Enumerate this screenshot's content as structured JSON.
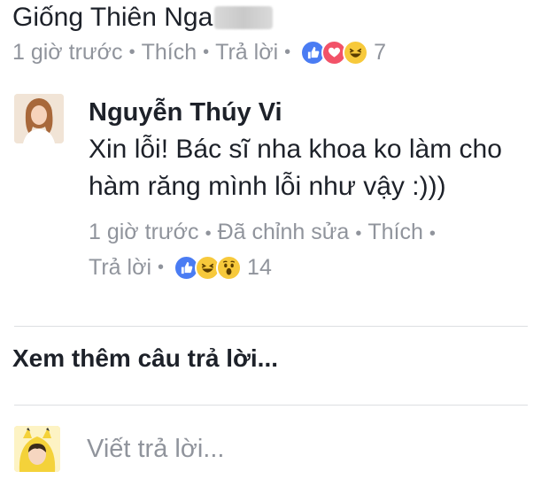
{
  "top_comment": {
    "author": "Giống Thiên Nga",
    "time": "1 giờ trước",
    "like_label": "Thích",
    "reply_label": "Trả lời",
    "reaction_icons": [
      "like-icon",
      "love-icon",
      "haha-icon"
    ],
    "reaction_count": "7"
  },
  "reply": {
    "author": "Nguyễn Thúy Vi",
    "text": "Xin lỗi! Bác sĩ nha khoa ko làm cho hàm răng mình lỗi như vậy :)))",
    "time": "1 giờ trước",
    "edited_label": "Đã chỉnh sửa",
    "like_label": "Thích",
    "reply_label": "Trả lời",
    "reaction_icons": [
      "like-icon",
      "haha-icon",
      "wow-icon"
    ],
    "reaction_count": "14"
  },
  "see_more_label": "Xem thêm câu trả lời...",
  "composer": {
    "placeholder": "Viết trả lời..."
  },
  "colors": {
    "meta_gray": "#90949c",
    "like_blue": "#4a7cf3",
    "love_red": "#f25268",
    "emoji_yellow": "#f7c93b",
    "divider": "#dddfe2"
  }
}
